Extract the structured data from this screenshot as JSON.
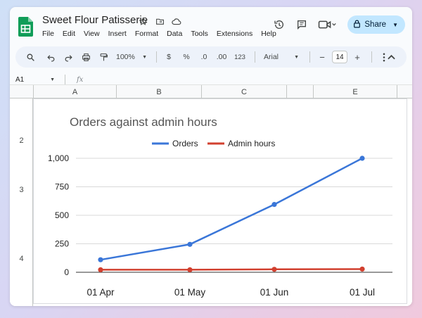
{
  "app": {
    "doc_title": "Sweet Flour Patisserie",
    "menu": [
      "File",
      "Edit",
      "View",
      "Insert",
      "Format",
      "Data",
      "Tools",
      "Extensions",
      "Help"
    ],
    "share_label": "Share"
  },
  "toolbar": {
    "zoom": "100%",
    "currency": "$",
    "percent": "%",
    "dec_decrease": ".0",
    "dec_increase": ".00",
    "number_format": "123",
    "font": "Arial",
    "font_size": "14"
  },
  "formula_bar": {
    "cell_ref": "A1",
    "fx": "fx"
  },
  "grid": {
    "columns": [
      "A",
      "B",
      "C",
      "",
      "E"
    ],
    "rows": [
      "2",
      "3",
      "4"
    ]
  },
  "colors": {
    "orders": "#3a76d8",
    "admin_hours": "#d2402f",
    "share_bg": "#c2e7ff",
    "sheets_green": "#0f9d58"
  },
  "chart_data": {
    "type": "line",
    "title": "Orders against admin hours",
    "categories": [
      "01 Apr",
      "01 May",
      "01 Jun",
      "01 Jul"
    ],
    "x_ticks": [
      "01 Apr",
      "01 May",
      "01 Jun",
      "01 Jul"
    ],
    "y_ticks": [
      "0",
      "250",
      "500",
      "750",
      "1,000"
    ],
    "ylim": [
      0,
      1000
    ],
    "grid": true,
    "legend_position": "top",
    "series": [
      {
        "name": "Orders",
        "values": [
          110,
          245,
          595,
          1000
        ]
      },
      {
        "name": "Admin hours",
        "values": [
          22,
          22,
          26,
          28
        ]
      }
    ]
  }
}
